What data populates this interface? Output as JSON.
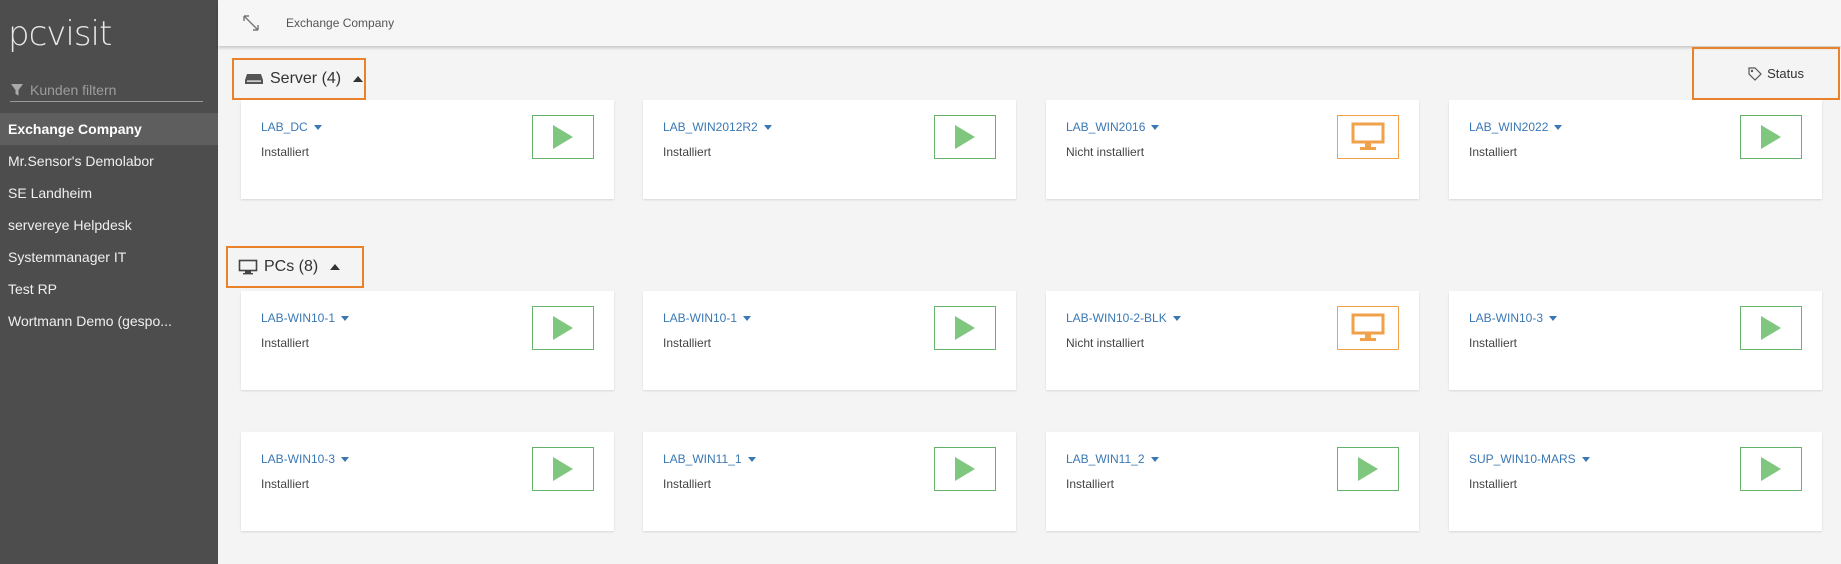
{
  "app": {
    "logo": "pcvisit"
  },
  "sidebar": {
    "filter_placeholder": "Kunden filtern",
    "items": [
      {
        "label": "Exchange Company",
        "active": true
      },
      {
        "label": "Mr.Sensor's Demolabor"
      },
      {
        "label": "SE Landheim"
      },
      {
        "label": "servereye Helpdesk"
      },
      {
        "label": "Systemmanager IT"
      },
      {
        "label": "Test RP"
      },
      {
        "label": "Wortmann Demo (gespo..."
      }
    ]
  },
  "topbar": {
    "breadcrumb": "Exchange Company",
    "expand_icon": "expand-arrows-icon"
  },
  "status_button": {
    "label": "Status",
    "icon": "tag-icon"
  },
  "groups": {
    "server": {
      "label": "Server (4)",
      "icon": "server-icon",
      "cards": [
        {
          "name": "LAB_DC",
          "state": "Installiert",
          "action": "play-icon"
        },
        {
          "name": "LAB_WIN2012R2",
          "state": "Installiert",
          "action": "play-icon"
        },
        {
          "name": "LAB_WIN2016",
          "state": "Nicht installiert",
          "action": "monitor-icon"
        },
        {
          "name": "LAB_WIN2022",
          "state": "Installiert",
          "action": "play-icon"
        }
      ]
    },
    "pcs": {
      "label": "PCs (8)",
      "icon": "monitor-icon",
      "cards": [
        {
          "name": "LAB-WIN10-1",
          "state": "Installiert",
          "action": "play-icon"
        },
        {
          "name": "LAB-WIN10-1",
          "state": "Installiert",
          "action": "play-icon"
        },
        {
          "name": "LAB-WIN10-2-BLK",
          "state": "Nicht installiert",
          "action": "monitor-icon"
        },
        {
          "name": "LAB-WIN10-3",
          "state": "Installiert",
          "action": "play-icon"
        },
        {
          "name": "LAB-WIN10-3",
          "state": "Installiert",
          "action": "play-icon"
        },
        {
          "name": "LAB_WIN11_1",
          "state": "Installiert",
          "action": "play-icon"
        },
        {
          "name": "LAB_WIN11_2",
          "state": "Installiert",
          "action": "play-icon"
        },
        {
          "name": "SUP_WIN10-MARS",
          "state": "Installiert",
          "action": "play-icon"
        }
      ]
    }
  },
  "colors": {
    "accent_orange": "#e8822b",
    "play_green": "#7fc77f",
    "link_blue": "#3a78b5",
    "sidebar_bg": "#4d4d4d"
  }
}
